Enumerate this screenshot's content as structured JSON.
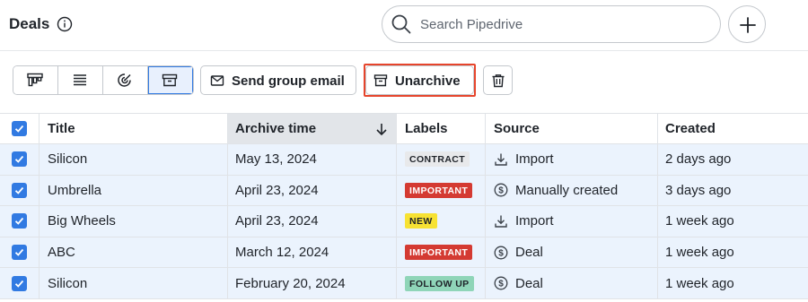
{
  "header": {
    "title": "Deals",
    "search": {
      "placeholder": "Search Pipedrive",
      "value": ""
    }
  },
  "toolbar": {
    "view_buttons": [
      {
        "icon": "pipeline-view-icon",
        "active": false
      },
      {
        "icon": "list-view-icon",
        "active": false
      },
      {
        "icon": "forecast-view-icon",
        "active": false
      },
      {
        "icon": "archive-view-icon",
        "active": true
      }
    ],
    "send_email_label": "Send group email",
    "unarchive_label": "Unarchive",
    "delete_icon": "trash-icon"
  },
  "table": {
    "columns": [
      "Title",
      "Archive time",
      "Labels",
      "Source",
      "Created"
    ],
    "sort_column": "Archive time",
    "sort_direction": "descending",
    "rows": [
      {
        "checked": true,
        "title": "Silicon",
        "archive_time": "May 13, 2024",
        "label": "CONTRACT",
        "source": "Import",
        "source_icon": "download-icon",
        "created": "2 days ago"
      },
      {
        "checked": true,
        "title": "Umbrella",
        "archive_time": "April 23, 2024",
        "label": "IMPORTANT",
        "source": "Manually created",
        "source_icon": "dollar-circle-icon",
        "created": "3 days ago"
      },
      {
        "checked": true,
        "title": "Big Wheels",
        "archive_time": "April 23, 2024",
        "label": "NEW",
        "source": "Import",
        "source_icon": "download-icon",
        "created": "1 week ago"
      },
      {
        "checked": true,
        "title": "ABC",
        "archive_time": "March 12, 2024",
        "label": "IMPORTANT",
        "source": "Deal",
        "source_icon": "dollar-circle-icon",
        "created": "1 week ago"
      },
      {
        "checked": true,
        "title": "Silicon",
        "archive_time": "February 20, 2024",
        "label": "FOLLOW UP",
        "source": "Deal",
        "source_icon": "dollar-circle-icon",
        "created": "1 week ago"
      }
    ]
  },
  "colors": {
    "accent": "#317ae2",
    "selected_row": "#ebf3fd",
    "highlight_border": "#e6452c",
    "label_contract_bg": "#e8e9eb",
    "label_important_bg": "#d43a32",
    "label_new_bg": "#f7e233",
    "label_follow_up_bg": "#8fd5b8"
  }
}
